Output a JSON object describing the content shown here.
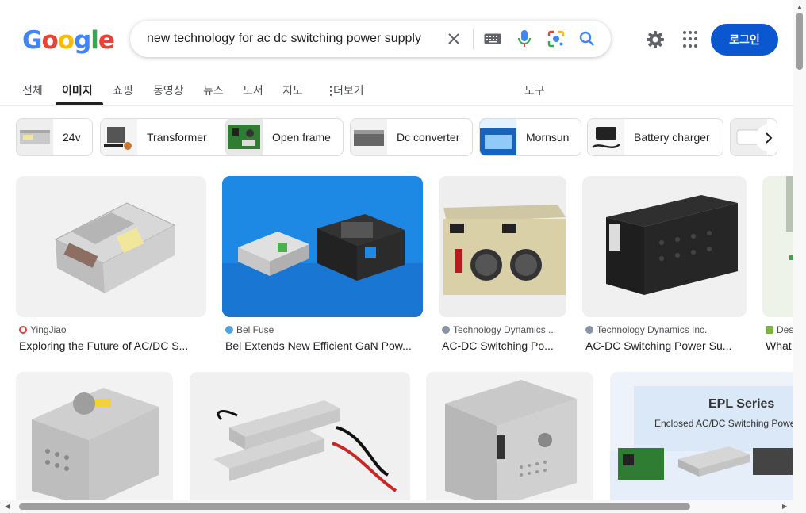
{
  "header": {
    "logo": [
      "G",
      "o",
      "o",
      "g",
      "l",
      "e"
    ],
    "logo_colors": [
      "#4285f4",
      "#ea4335",
      "#fbbc05",
      "#4285f4",
      "#34a853",
      "#ea4335"
    ],
    "search_query": "new technology for ac dc switching power supply",
    "login_label": "로그인"
  },
  "tabs": {
    "all": "전체",
    "images": "이미지",
    "shopping": "쇼핑",
    "videos": "동영상",
    "news": "뉴스",
    "books": "도서",
    "maps": "지도",
    "more": "더보기",
    "tools": "도구"
  },
  "chips": [
    "24v",
    "Transformer",
    "Open frame",
    "Dc converter",
    "Mornsun",
    "Battery charger"
  ],
  "results": [
    {
      "source": "YingJiao",
      "title": "Exploring the Future of AC/DC S...",
      "favicon_color": "#e53935"
    },
    {
      "source": "Bel Fuse",
      "title": "Bel Extends New Efficient GaN Pow...",
      "favicon_color": "#4fa3e0"
    },
    {
      "source": "Technology Dynamics ...",
      "title": "AC-DC Switching Po...",
      "favicon_color": "#8a94a6"
    },
    {
      "source": "Technology Dynamics Inc.",
      "title": "AC-DC Switching Power Su...",
      "favicon_color": "#8a94a6"
    },
    {
      "source": "Des",
      "title": "What",
      "favicon_color": "#7cb342"
    }
  ],
  "row2": {
    "epl_title": "EPL Series",
    "epl_subtitle": "Enclosed AC/DC Switching Power"
  },
  "colors": {
    "accent": "#0b57d0",
    "active_tab": "#202124"
  }
}
